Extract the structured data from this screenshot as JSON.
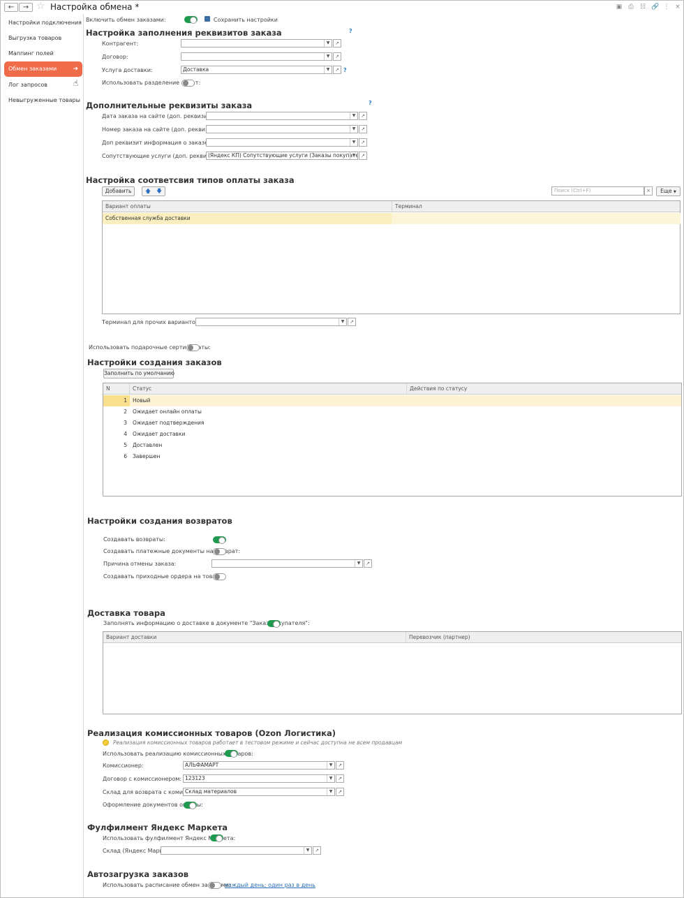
{
  "window": {
    "title": "Настройка обмена *"
  },
  "toolbar": {
    "enable_exchange_label": "Включить обмен заказами:",
    "save_settings_label": "Сохранить настройки"
  },
  "sidebar": {
    "items": [
      {
        "label": "Настройки подключения"
      },
      {
        "label": "Выгрузка товаров"
      },
      {
        "label": "Маппинг полей"
      },
      {
        "label": "Обмен заказами"
      },
      {
        "label": "Лог запросов"
      },
      {
        "label": "Невыгруженные товары"
      }
    ]
  },
  "order_fill": {
    "title": "Настройка заполнения реквизитов заказа",
    "help": "?",
    "contractor_label": "Контрагент:",
    "contractor_value": "",
    "contract_label": "Договор:",
    "contract_value": "",
    "delivery_label": "Услуга доставки:",
    "delivery_value": "Доставка",
    "split_label": "Использовать разделение оплат:"
  },
  "extra_props": {
    "title": "Дополнительные реквизиты заказа",
    "help": "?",
    "rows": [
      {
        "label": "Дата заказа на сайте (доп. реквизит):",
        "value": ""
      },
      {
        "label": "Номер заказа на сайте (доп. реквизит):",
        "value": ""
      },
      {
        "label": "Доп реквизит информация о заказе с сайта:",
        "value": ""
      },
      {
        "label": "Сопутствующие услуги (доп. реквизит):",
        "value": "(Яндекс КП) Сопутствующие услуги (Заказы покупателей)"
      }
    ]
  },
  "payment_types": {
    "title": "Настройка соответсвия типов оплаты заказа",
    "add_label": "Добавить",
    "search_placeholder": "Поиск (Ctrl+F)",
    "more_label": "Еще",
    "columns": [
      "Вариант оплаты",
      "Терминал"
    ],
    "rows": [
      {
        "variant": "Собственная служба доставки",
        "terminal": ""
      }
    ],
    "other_terminal_label": "Терминал для прочих вариантов оплат:"
  },
  "gift_certificates_label": "Использовать подарочные сертификаты:",
  "order_creation": {
    "title": "Настройки создания заказов",
    "fill_default_label": "Заполнить по умолчанию",
    "columns": [
      "N",
      "Статус",
      "Действия по статусу"
    ],
    "rows": [
      {
        "n": "1",
        "status": "Новый",
        "action": ""
      },
      {
        "n": "2",
        "status": "Ожидает онлайн оплаты",
        "action": ""
      },
      {
        "n": "3",
        "status": "Ожидает подтверждения",
        "action": ""
      },
      {
        "n": "4",
        "status": "Ожидает доставки",
        "action": ""
      },
      {
        "n": "5",
        "status": "Доставлен",
        "action": ""
      },
      {
        "n": "6",
        "status": "Завершен",
        "action": ""
      }
    ]
  },
  "returns": {
    "title": "Настройки создания возвратов",
    "create_returns_label": "Создавать возвраты:",
    "create_payment_docs_label": "Создавать платежные документы на возврат:",
    "cancel_reason_label": "Причина отмены заказа:",
    "cancel_reason_value": "",
    "create_receipts_label": "Создавать приходные ордера на товары:"
  },
  "delivery": {
    "title": "Доставка товара",
    "fill_info_label": "Заполнять информацию о доставке в документе \"Заказ покупателя\":",
    "columns": [
      "Вариант доставки",
      "Перевозчик (партнер)"
    ]
  },
  "commission": {
    "title": "Реализация комиссионных товаров (Ozon Логистика)",
    "notice": "Реализация комиссионных товаров работает в тестовом режиме и сейчас доступна не всем продавцам",
    "use_label": "Использовать реализацию комиссионных товаров:",
    "commissioner_label": "Комиссионер:",
    "commissioner_value": "АЛЬФАМАРТ",
    "contract_label": "Договор с комиссионером:",
    "contract_value": "123123",
    "warehouse_label": "Склад для возврата с комиссии:",
    "warehouse_value": "Склад материалов",
    "payment_docs_label": "Оформление документов оплаты:"
  },
  "fulfillment": {
    "title": "Фулфилмент Яндекс Маркета",
    "use_label": "Использовать фулфилмент Яндекс Маркета:",
    "warehouse_label": "Склад (Яндекс Маркет):",
    "warehouse_value": ""
  },
  "autoload": {
    "title": "Автозагрузка заказов",
    "schedule_label": "Использовать расписание обмен заказами:",
    "schedule_link": "каждый день; один раз в день"
  }
}
